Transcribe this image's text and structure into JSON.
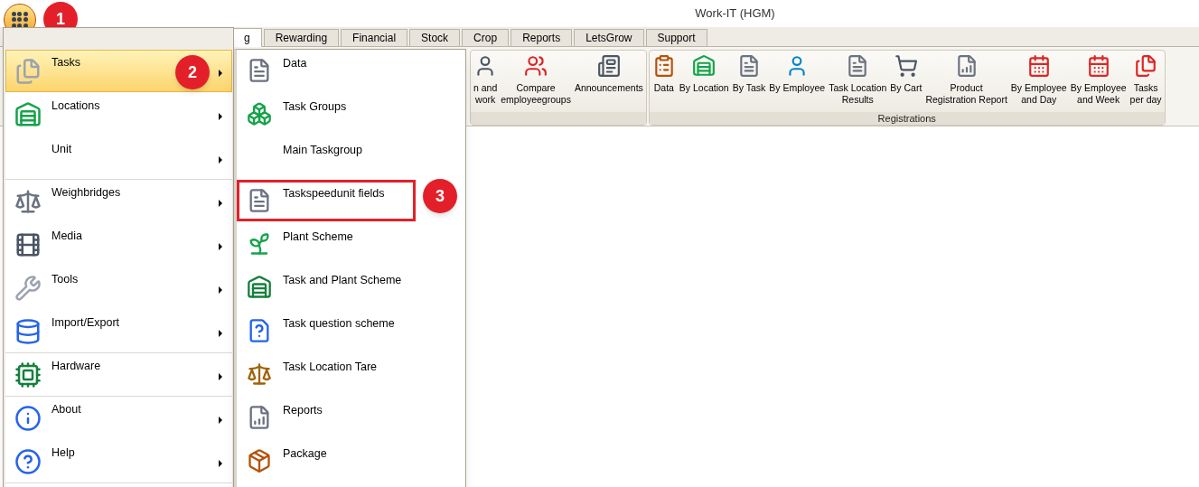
{
  "window": {
    "title": "Work-IT (HGM)"
  },
  "app_button": {
    "marker": "1"
  },
  "tabs": [
    {
      "label": "g",
      "selected": true
    },
    {
      "label": "Rewarding",
      "selected": false
    },
    {
      "label": "Financial",
      "selected": false
    },
    {
      "label": "Stock",
      "selected": false
    },
    {
      "label": "Crop",
      "selected": false
    },
    {
      "label": "Reports",
      "selected": false
    },
    {
      "label": "LetsGrow",
      "selected": false
    },
    {
      "label": "Support",
      "selected": false
    }
  ],
  "ribbon": {
    "groups": [
      {
        "items": [
          {
            "label": "n and\nwork"
          },
          {
            "label": "Compare\nemployeegroups"
          },
          {
            "label": "Announcements"
          }
        ]
      },
      {
        "label": "Registrations",
        "items": [
          {
            "label": "Data"
          },
          {
            "label": "By Location"
          },
          {
            "label": "By Task"
          },
          {
            "label": "By Employee"
          },
          {
            "label": "Task Location\nResults"
          },
          {
            "label": "By Cart"
          },
          {
            "label": "Product\nRegistration Report"
          },
          {
            "label": "By Employee\nand Day"
          },
          {
            "label": "By Employee\nand Week"
          },
          {
            "label": "Tasks\nper day"
          }
        ]
      }
    ]
  },
  "menu": {
    "items": [
      {
        "label": "Tasks",
        "selected": true,
        "marker": "2",
        "separator": false
      },
      {
        "label": "Locations",
        "selected": false,
        "separator": false
      },
      {
        "label": "Unit",
        "selected": false,
        "separator": true
      },
      {
        "label": "Weighbridges",
        "selected": false,
        "separator": false
      },
      {
        "label": "Media",
        "selected": false,
        "separator": false
      },
      {
        "label": "Tools",
        "selected": false,
        "separator": false
      },
      {
        "label": "Import/Export",
        "selected": false,
        "separator": true
      },
      {
        "label": "Hardware",
        "selected": false,
        "separator": true
      },
      {
        "label": "About",
        "selected": false,
        "separator": false
      },
      {
        "label": "Help",
        "selected": false,
        "separator": true
      }
    ],
    "submenu": [
      {
        "label": "Data",
        "highlighted": false
      },
      {
        "label": "Task Groups",
        "highlighted": false
      },
      {
        "label": "Main Taskgroup",
        "highlighted": false
      },
      {
        "label": "Taskspeedunit fields",
        "highlighted": true,
        "marker": "3"
      },
      {
        "label": "Plant Scheme",
        "highlighted": false
      },
      {
        "label": "Task and Plant Scheme",
        "highlighted": false
      },
      {
        "label": "Task question scheme",
        "highlighted": false
      },
      {
        "label": "Task Location Tare",
        "highlighted": false
      },
      {
        "label": "Reports",
        "highlighted": false
      },
      {
        "label": "Package",
        "highlighted": false
      }
    ]
  }
}
